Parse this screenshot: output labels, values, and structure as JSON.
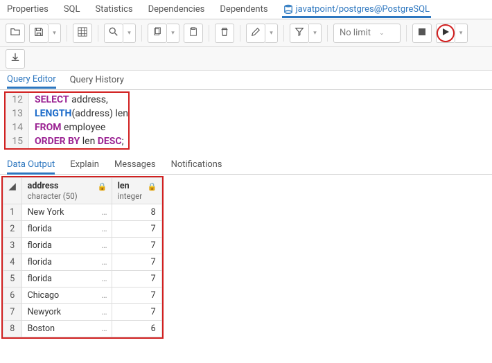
{
  "top_tabs": {
    "properties": "Properties",
    "sql": "SQL",
    "statistics": "Statistics",
    "dependencies": "Dependencies",
    "dependents": "Dependents",
    "connection": "javatpoint/postgres@PostgreSQL"
  },
  "toolbar": {
    "limit_label": "No limit"
  },
  "editor_tabs": {
    "query_editor": "Query Editor",
    "query_history": "Query History"
  },
  "editor": {
    "lines": [
      {
        "num": "12",
        "tokens": [
          [
            "kw",
            "SELECT"
          ],
          [
            "pl",
            " address,"
          ]
        ]
      },
      {
        "num": "13",
        "tokens": [
          [
            "fn",
            "LENGTH"
          ],
          [
            "pl",
            "(address) len"
          ]
        ]
      },
      {
        "num": "14",
        "tokens": [
          [
            "kw",
            "FROM"
          ],
          [
            "pl",
            " employee"
          ]
        ]
      },
      {
        "num": "15",
        "tokens": [
          [
            "kw",
            "ORDER BY"
          ],
          [
            "pl",
            " len "
          ],
          [
            "kw",
            "DESC"
          ],
          [
            "pl",
            ";"
          ]
        ]
      }
    ]
  },
  "result_tabs": {
    "data_output": "Data Output",
    "explain": "Explain",
    "messages": "Messages",
    "notifications": "Notifications"
  },
  "grid": {
    "columns": [
      {
        "name": "address",
        "type": "character (50)"
      },
      {
        "name": "len",
        "type": "integer"
      }
    ],
    "rows": [
      {
        "n": "1",
        "address": "New York",
        "len": "8"
      },
      {
        "n": "2",
        "address": "florida",
        "len": "7"
      },
      {
        "n": "3",
        "address": "florida",
        "len": "7"
      },
      {
        "n": "4",
        "address": "florida",
        "len": "7"
      },
      {
        "n": "5",
        "address": "florida",
        "len": "7"
      },
      {
        "n": "6",
        "address": "Chicago",
        "len": "7"
      },
      {
        "n": "7",
        "address": "Newyork",
        "len": "7"
      },
      {
        "n": "8",
        "address": "Boston",
        "len": "6"
      }
    ]
  }
}
